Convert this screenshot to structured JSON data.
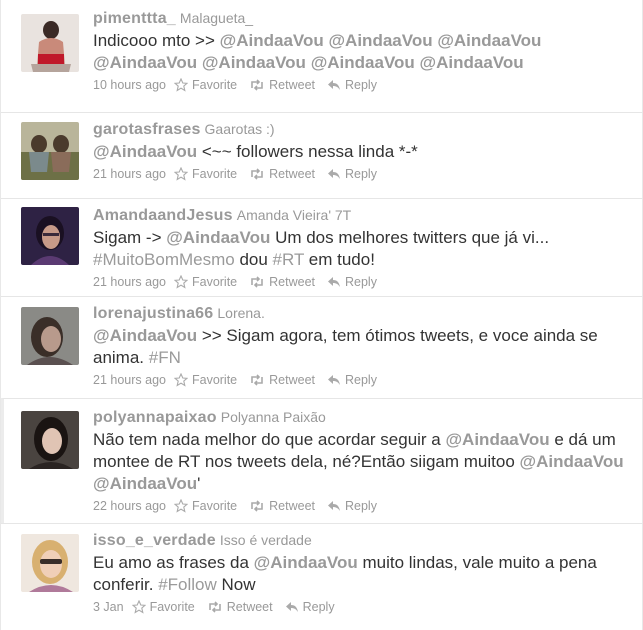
{
  "colors": {
    "muted": "#999999",
    "text": "#333333",
    "divider": "#e6e6e6"
  },
  "action_icons": {
    "favorite": "star-icon",
    "retweet": "retweet-icon",
    "reply": "reply-icon"
  },
  "tweets": [
    {
      "username": "pimenttta_",
      "fullname": "Malagueta_",
      "text": [
        {
          "t": "Indicooo mto >> "
        },
        {
          "t": "@AindaaVou",
          "k": "m"
        },
        {
          "t": " "
        },
        {
          "t": "@AindaaVou",
          "k": "m"
        },
        {
          "t": " "
        },
        {
          "t": "@AindaaVou",
          "k": "m"
        },
        {
          "t": " "
        },
        {
          "t": "@AindaaVou",
          "k": "m"
        },
        {
          "t": " "
        },
        {
          "t": "@AindaaVou",
          "k": "m"
        },
        {
          "t": " "
        },
        {
          "t": "@AindaaVou",
          "k": "m"
        },
        {
          "t": " "
        },
        {
          "t": "@AindaaVou",
          "k": "m"
        }
      ],
      "time": "10 hours ago",
      "favorite_label": "Favorite",
      "retweet_label": "Retweet",
      "reply_label": "Reply"
    },
    {
      "username": "garotasfrases",
      "fullname": "Gaarotas :)",
      "text": [
        {
          "t": "@AindaaVou",
          "k": "m"
        },
        {
          "t": " <~~ followers nessa linda *-*"
        }
      ],
      "time": "21 hours ago",
      "favorite_label": "Favorite",
      "retweet_label": "Retweet",
      "reply_label": "Reply"
    },
    {
      "username": "AmandaandJesus",
      "fullname": "Amanda Vieira' 7T",
      "text": [
        {
          "t": "Sigam -> "
        },
        {
          "t": "@AindaaVou",
          "k": "m"
        },
        {
          "t": " Um dos melhores twitters que já vi... "
        },
        {
          "t": "#MuitoBomMesmo",
          "k": "h"
        },
        {
          "t": " dou "
        },
        {
          "t": "#RT",
          "k": "h"
        },
        {
          "t": " em tudo!"
        }
      ],
      "time": "21 hours ago",
      "favorite_label": "Favorite",
      "retweet_label": "Retweet",
      "reply_label": "Reply"
    },
    {
      "username": "lorenajustina66",
      "fullname": "Lorena.",
      "text": [
        {
          "t": "@AindaaVou",
          "k": "m"
        },
        {
          "t": " >> Sigam agora, tem ótimos tweets, e voce ainda se anima. "
        },
        {
          "t": "#FN",
          "k": "h"
        }
      ],
      "time": "21 hours ago",
      "favorite_label": "Favorite",
      "retweet_label": "Retweet",
      "reply_label": "Reply"
    },
    {
      "username": "polyannapaixao",
      "fullname": "Polyanna Paixão",
      "text": [
        {
          "t": "Não tem nada melhor do que acordar seguir a "
        },
        {
          "t": "@AindaaVou",
          "k": "m"
        },
        {
          "t": " e dá um montee de RT nos tweets dela, né?Então siigam muitoo "
        },
        {
          "t": "@AindaaVou",
          "k": "m"
        },
        {
          "t": " "
        },
        {
          "t": "@AindaaVou",
          "k": "m"
        },
        {
          "t": "'"
        }
      ],
      "time": "22 hours ago",
      "favorite_label": "Favorite",
      "retweet_label": "Retweet",
      "reply_label": "Reply"
    },
    {
      "username": "isso_e_verdade",
      "fullname": "Isso é verdade",
      "text": [
        {
          "t": "Eu amo as frases da "
        },
        {
          "t": "@AindaaVou",
          "k": "m"
        },
        {
          "t": " muito lindas, vale muito a pena conferir. "
        },
        {
          "t": "#Follow",
          "k": "h"
        },
        {
          "t": " Now"
        }
      ],
      "time": "3 Jan",
      "favorite_label": "Favorite",
      "retweet_label": "Retweet",
      "reply_label": "Reply"
    }
  ]
}
